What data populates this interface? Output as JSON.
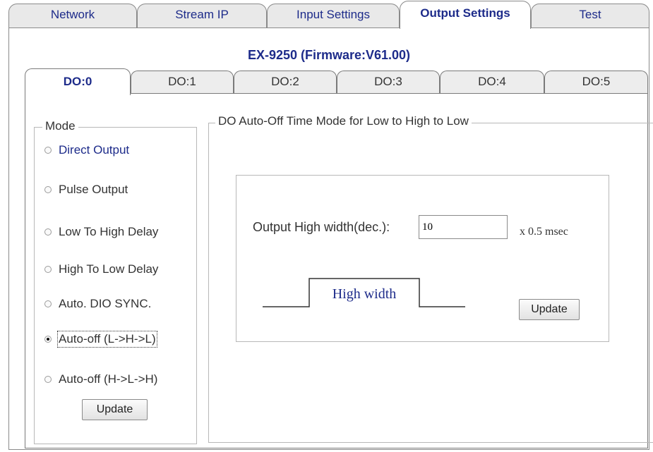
{
  "top_tabs": [
    {
      "label": "Network",
      "active": false
    },
    {
      "label": "Stream IP",
      "active": false
    },
    {
      "label": "Input Settings",
      "active": false
    },
    {
      "label": "Output Settings",
      "active": true
    },
    {
      "label": "Test",
      "active": false
    }
  ],
  "device_title": "EX-9250 (Firmware:V61.00)",
  "do_tabs": [
    {
      "label": "DO:0",
      "active": true
    },
    {
      "label": "DO:1",
      "active": false
    },
    {
      "label": "DO:2",
      "active": false
    },
    {
      "label": "DO:3",
      "active": false
    },
    {
      "label": "DO:4",
      "active": false
    },
    {
      "label": "DO:5",
      "active": false
    }
  ],
  "mode": {
    "legend": "Mode",
    "options": [
      {
        "label": "Direct Output",
        "checked": false
      },
      {
        "label": "Pulse Output",
        "checked": false
      },
      {
        "label": "Low To High Delay",
        "checked": false
      },
      {
        "label": "High To Low Delay",
        "checked": false
      },
      {
        "label": "Auto. DIO SYNC.",
        "checked": false
      },
      {
        "label": "Auto-off (L->H->L)",
        "checked": true
      },
      {
        "label": "Auto-off (H->L->H)",
        "checked": false
      }
    ],
    "update_label": "Update"
  },
  "auto_off": {
    "legend": "DO Auto-Off Time Mode for Low to High to Low",
    "input_label": "Output High width(dec.):",
    "input_value": "10",
    "unit": "x 0.5 msec",
    "waveform_label": "High width",
    "update_label": "Update"
  },
  "colors": {
    "accent": "#1d2b8a",
    "border": "#8a8a8a"
  }
}
